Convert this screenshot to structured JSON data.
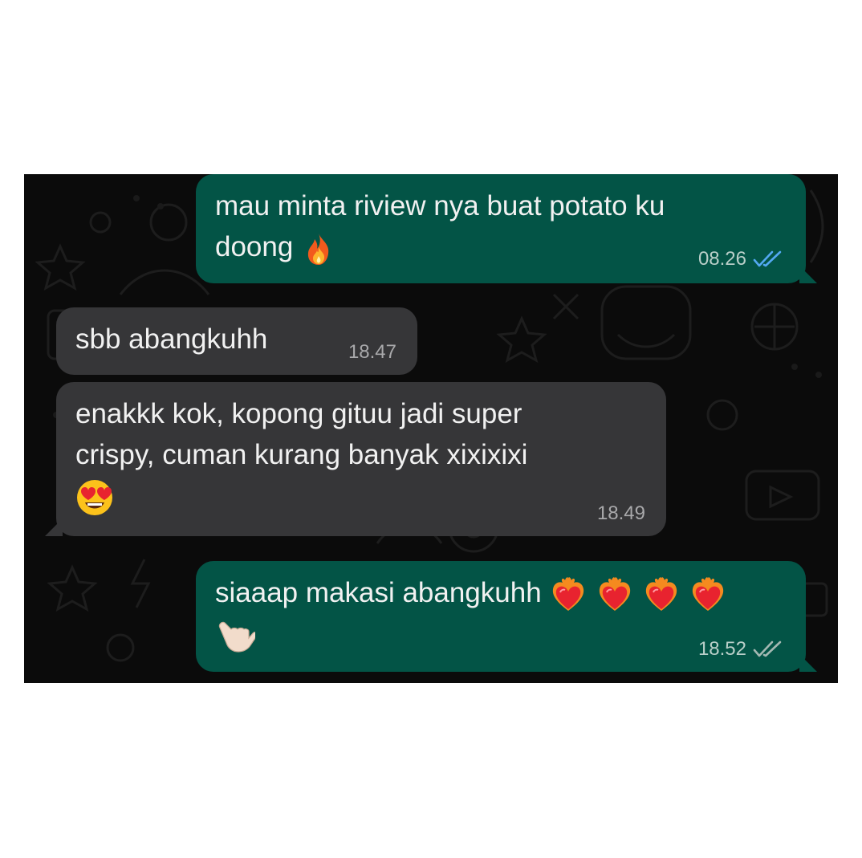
{
  "colors": {
    "outgoing_bubble": "#035446",
    "incoming_bubble": "#363638",
    "chat_background": "#0b0b0b",
    "read_ticks": "#53a8f2",
    "delivered_ticks": "#a3b8b2"
  },
  "messages": [
    {
      "direction": "outgoing",
      "text_line1": "mau minta riview nya buat potato ku",
      "text_line2": "doong",
      "emoji": "fire-icon",
      "time": "08.26",
      "status": "read"
    },
    {
      "direction": "incoming",
      "text": "sbb abangkuhh",
      "time": "18.47"
    },
    {
      "direction": "incoming",
      "text_line1": "enakkk kok, kopong gituu jadi super",
      "text_line2": "crispy, cuman kurang banyak xixixixi",
      "emoji": "heart-eyes-face-icon",
      "time": "18.49"
    },
    {
      "direction": "outgoing",
      "text": "siaaap makasi abangkuhh",
      "emojis": [
        "heart-on-fire-icon",
        "heart-on-fire-icon",
        "heart-on-fire-icon",
        "heart-on-fire-icon",
        "call-me-hand-icon"
      ],
      "time": "18.52",
      "status": "delivered"
    }
  ]
}
